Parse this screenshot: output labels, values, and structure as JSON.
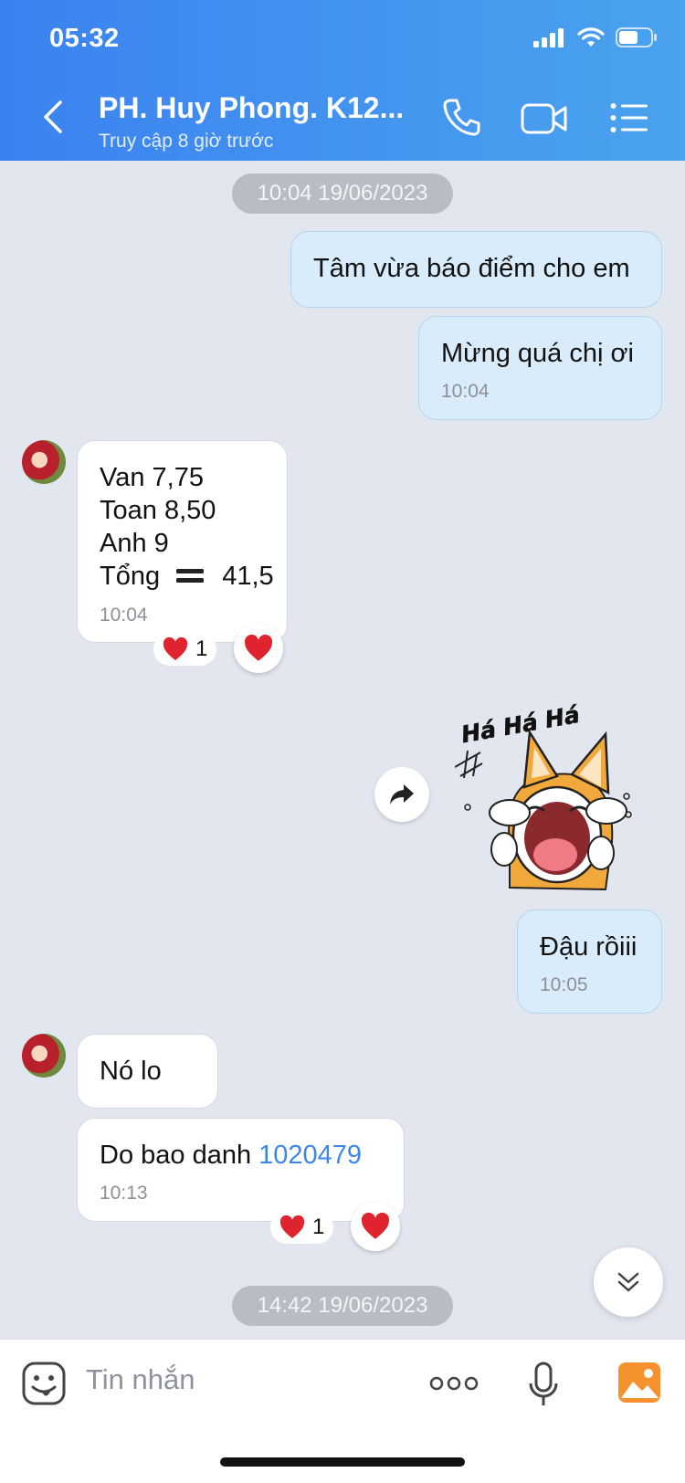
{
  "status": {
    "time": "05:32"
  },
  "header": {
    "title": "PH. Huy Phong. K12...",
    "subtitle": "Truy cập 8 giờ trước",
    "color_start": "#3b82f0",
    "color_end": "#4aa3ee"
  },
  "messages": {
    "date1": "10:04 19/06/2023",
    "m1": "Tâm vừa báo điểm cho em",
    "m2": "Mừng quá chị ơi",
    "m2_time": "10:04",
    "m3_lines": [
      "Van 7,75",
      "Toan 8,50",
      "Anh 9",
      "Tổng",
      "41,5"
    ],
    "m3_time": "10:04",
    "m3_reaction_count": "1",
    "sticker_caption": "Há Há Há",
    "m4": "Đậu rồiii",
    "m4_time": "10:05",
    "m5": "Nó lo",
    "m6_prefix": "Do bao danh ",
    "m6_number": "1020479",
    "m6_time": "10:13",
    "m6_reaction_count": "1",
    "date2": "14:42 19/06/2023"
  },
  "input": {
    "placeholder": "Tin nhắn"
  },
  "colors": {
    "mine_bubble": "#d9ecfb",
    "theirs_bubble": "#ffffff",
    "background": "#e2e6ee",
    "link": "#3f86e8",
    "heart": "#e0242f"
  }
}
